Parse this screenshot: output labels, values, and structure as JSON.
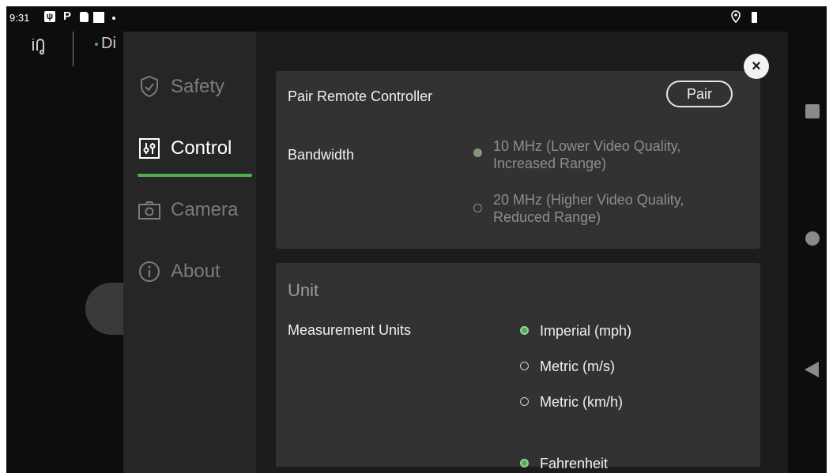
{
  "status_bar": {
    "time": "9:31",
    "icons": [
      "usb-icon",
      "p-icon",
      "sd-card-icon",
      "square-icon",
      "dot-icon",
      "location-icon",
      "battery-icon"
    ]
  },
  "background": {
    "app_text": "Di"
  },
  "sidebar": {
    "items": [
      {
        "label": "Safety",
        "icon": "shield-check-icon",
        "active": false
      },
      {
        "label": "Control",
        "icon": "sliders-icon",
        "active": true
      },
      {
        "label": "Camera",
        "icon": "camera-icon",
        "active": false
      },
      {
        "label": "About",
        "icon": "info-icon",
        "active": false
      }
    ]
  },
  "colors": {
    "accent": "#4caf50",
    "card_bg": "#323232",
    "dialog_bg": "#1c1c1c",
    "sidebar_bg": "#262626"
  },
  "control": {
    "pair": {
      "label": "Pair Remote Controller",
      "button": "Pair"
    },
    "bandwidth": {
      "label": "Bandwidth",
      "options": [
        {
          "line1": "10 MHz (Lower Video Quality,",
          "line2": "Increased Range)",
          "selected": true
        },
        {
          "line1": "20 MHz (Higher Video Quality,",
          "line2": "Reduced Range)",
          "selected": false
        }
      ]
    }
  },
  "unit": {
    "title": "Unit",
    "measurement_label": "Measurement Units",
    "options": [
      {
        "label": "Imperial (mph)",
        "selected": true
      },
      {
        "label": "Metric (m/s)",
        "selected": false
      },
      {
        "label": "Metric (km/h)",
        "selected": false
      }
    ],
    "temperature_option": {
      "label": "Fahrenheit",
      "selected": true
    }
  },
  "dialog": {
    "close_symbol": "×"
  }
}
